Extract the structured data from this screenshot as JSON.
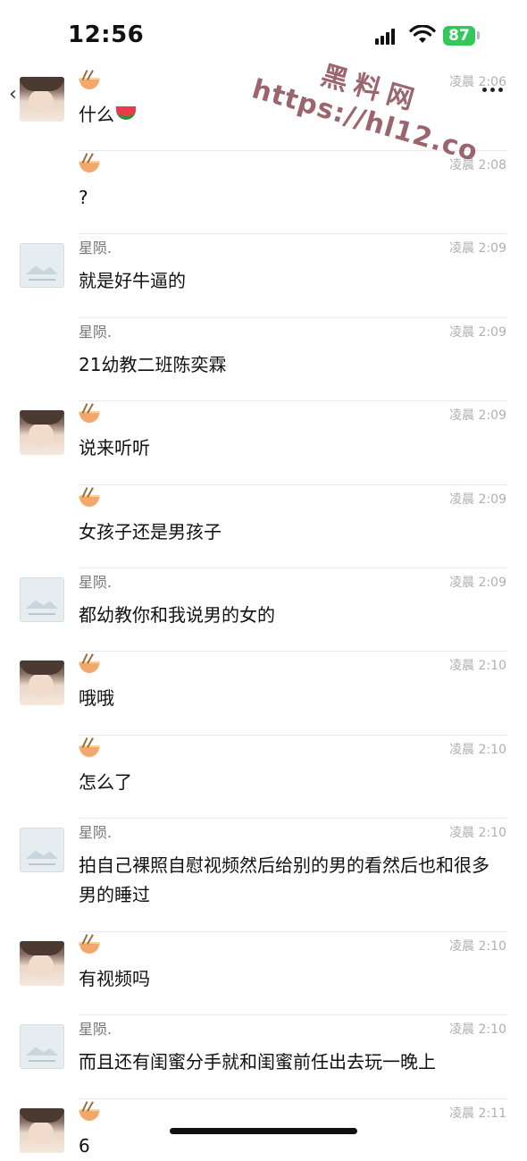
{
  "status": {
    "time": "12:56",
    "battery": "87"
  },
  "watermark": {
    "line1": "黑料网",
    "line2": "https://hl12.co"
  },
  "messages": [
    {
      "sender": "self",
      "name": "",
      "time": "凌晨 2:06",
      "text": "什么",
      "emoji": "watermelon"
    },
    {
      "sender": "self",
      "name": "",
      "time": "凌晨 2:08",
      "text": "?"
    },
    {
      "sender": "other",
      "name": "星陨.",
      "time": "凌晨 2:09",
      "text": "就是好牛逼的"
    },
    {
      "sender": "other",
      "name": "星陨.",
      "time": "凌晨 2:09",
      "text": "21幼教二班陈奕霖"
    },
    {
      "sender": "self",
      "name": "",
      "time": "凌晨 2:09",
      "text": "说来听听"
    },
    {
      "sender": "self",
      "name": "",
      "time": "凌晨 2:09",
      "text": "女孩子还是男孩子"
    },
    {
      "sender": "other",
      "name": "星陨.",
      "time": "凌晨 2:09",
      "text": "都幼教你和我说男的女的"
    },
    {
      "sender": "self",
      "name": "",
      "time": "凌晨 2:10",
      "text": "哦哦"
    },
    {
      "sender": "self",
      "name": "",
      "time": "凌晨 2:10",
      "text": "怎么了"
    },
    {
      "sender": "other",
      "name": "星陨.",
      "time": "凌晨 2:10",
      "text": "拍自己裸照自慰视频然后给别的男的看然后也和很多男的睡过"
    },
    {
      "sender": "self",
      "name": "",
      "time": "凌晨 2:10",
      "text": "有视频吗"
    },
    {
      "sender": "other",
      "name": "星陨.",
      "time": "凌晨 2:10",
      "text": "而且还有闺蜜分手就和闺蜜前任出去玩一晚上"
    },
    {
      "sender": "self",
      "name": "",
      "time": "凌晨 2:11",
      "text": "6"
    }
  ]
}
